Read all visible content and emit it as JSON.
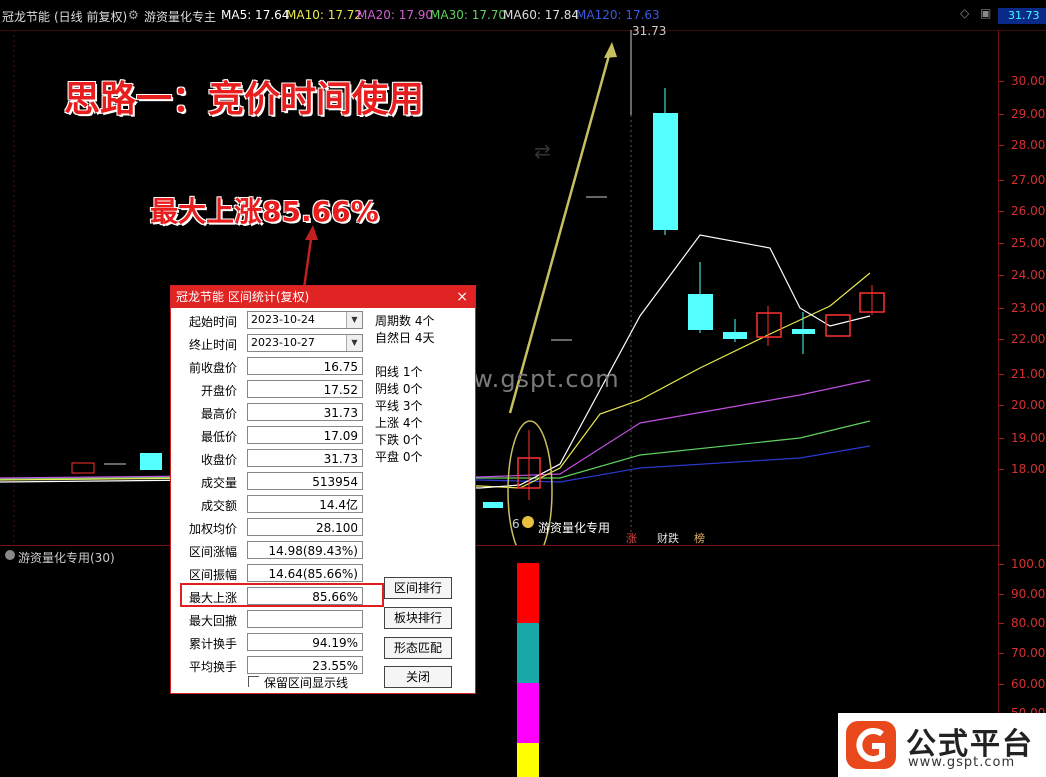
{
  "header": {
    "stock": "冠龙节能",
    "period": "(日线 前复权)",
    "indicator": "游资量化专主",
    "ma5": "MA5: 17.64",
    "ma10": "MA10: 17.72",
    "ma20": "MA20: 17.90",
    "ma30": "MA30: 17.70",
    "ma60": "MA60: 17.84",
    "ma120": "MA120: 17.63",
    "current_price": "31.73"
  },
  "price_axis": [
    "30.00",
    "29.00",
    "28.00",
    "27.00",
    "26.00",
    "25.00",
    "24.00",
    "23.00",
    "22.00",
    "21.00",
    "20.00",
    "19.00",
    "18.00"
  ],
  "osc_axis": [
    "100.0",
    "90.00",
    "80.00",
    "70.00",
    "60.00",
    "50.00"
  ],
  "annotations": {
    "headline": "思路一：竞价时间使用",
    "max_rise": "最大上涨85.66%",
    "peak_label": "31.73",
    "watermark": "www.gspt.com",
    "low_label": "6",
    "marker_label": "游资量化专用",
    "badge_1": "涨",
    "badge_2": "财跌",
    "badge_3": "榜"
  },
  "lower_panel": {
    "title": "游资量化专用(30)"
  },
  "dialog": {
    "title": "冠龙节能 区间统计(复权)",
    "close": "×",
    "start_label": "起始时间",
    "start_value": "2023-10-24",
    "end_label": "终止时间",
    "end_value": "2023-10-27",
    "rows": [
      {
        "label": "前收盘价",
        "value": "16.75"
      },
      {
        "label": "开盘价",
        "value": "17.52"
      },
      {
        "label": "最高价",
        "value": "31.73"
      },
      {
        "label": "最低价",
        "value": "17.09"
      },
      {
        "label": "收盘价",
        "value": "31.73"
      },
      {
        "label": "成交量",
        "value": "513954"
      },
      {
        "label": "成交额",
        "value": "14.4亿"
      },
      {
        "label": "加权均价",
        "value": "28.100"
      },
      {
        "label": "区间涨幅",
        "value": "14.98(89.43%)"
      },
      {
        "label": "区间振幅",
        "value": "14.64(85.66%)"
      },
      {
        "label": "最大上涨",
        "value": "85.66%"
      },
      {
        "label": "最大回撤",
        "value": ""
      },
      {
        "label": "累计换手",
        "value": "94.19%"
      },
      {
        "label": "平均换手",
        "value": "23.55%"
      }
    ],
    "stats": [
      "周期数 4个",
      "自然日 4天",
      "阳线 1个",
      "阴线 0个",
      "平线 3个",
      "上涨 4个",
      "下跌 0个",
      "平盘 0个"
    ],
    "buttons": [
      "区间排行",
      "板块排行",
      "形态匹配",
      "关闭"
    ],
    "checkbox_label": "保留区间显示线"
  },
  "brand": {
    "name": "公式平台",
    "url": "www.gspt.com"
  },
  "colors": {
    "up": "#ff3030",
    "down": "#54ffff",
    "axis": "#d63030",
    "ma_white": "#ffffff",
    "ma_yellow": "#e8e850",
    "ma_purple": "#c050e0",
    "ma_green": "#60d060",
    "ma_blue": "#2a3ad0"
  }
}
